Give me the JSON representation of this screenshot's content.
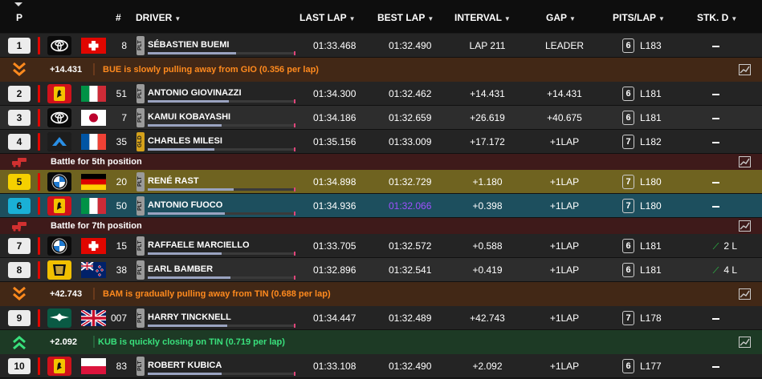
{
  "headers": {
    "pos": "P",
    "num": "#",
    "driver": "DRIVER",
    "last_lap": "LAST LAP",
    "best_lap": "BEST LAP",
    "interval": "INTERVAL",
    "gap": "GAP",
    "pits": "PITS/LAP",
    "stk": "STK. D"
  },
  "colors": {
    "team_bar": "#e10600",
    "purple_lap": "#a050ff",
    "orange_msg": "#ff8a1e",
    "green_msg": "#39e07c",
    "gain": "#2dcf4a"
  },
  "rows": [
    {
      "pos": "1",
      "num": "8",
      "tag": "PLT",
      "driver": "SÉBASTIEN BUEMI",
      "last": "01:33.468",
      "best": "01:32.490",
      "interval": "LAP 211",
      "gap": "LEADER",
      "pits": "6",
      "lap": "L183",
      "stk": "—",
      "team": "toyota",
      "flag": "switzerland"
    },
    {
      "pos": "2",
      "num": "51",
      "tag": "PLT",
      "driver": "ANTONIO GIOVINAZZI",
      "last": "01:34.300",
      "best": "01:32.462",
      "interval": "+14.431",
      "gap": "+14.431",
      "pits": "6",
      "lap": "L181",
      "stk": "—",
      "team": "ferrari",
      "flag": "italy"
    },
    {
      "pos": "3",
      "num": "7",
      "tag": "PLT",
      "driver": "KAMUI KOBAYASHI",
      "last": "01:34.186",
      "best": "01:32.659",
      "interval": "+26.619",
      "gap": "+40.675",
      "pits": "6",
      "lap": "L181",
      "stk": "—",
      "team": "toyota",
      "flag": "japan"
    },
    {
      "pos": "4",
      "num": "35",
      "tag": "GLD",
      "driver": "CHARLES MILESI",
      "last": "01:35.156",
      "best": "01:33.009",
      "interval": "+17.172",
      "gap": "+1LAP",
      "pits": "7",
      "lap": "L182",
      "stk": "—",
      "team": "alpine",
      "flag": "france"
    },
    {
      "pos": "5",
      "num": "20",
      "tag": "PLT",
      "driver": "RENÉ RAST",
      "last": "01:34.898",
      "best": "01:32.729",
      "interval": "+1.180",
      "gap": "+1LAP",
      "pits": "7",
      "lap": "L180",
      "stk": "—",
      "team": "bmw",
      "flag": "germany"
    },
    {
      "pos": "6",
      "num": "50",
      "tag": "PLT",
      "driver": "ANTONIO FUOCO",
      "last": "01:34.936",
      "best": "01:32.066",
      "interval": "+0.398",
      "gap": "+1LAP",
      "pits": "7",
      "lap": "L180",
      "stk": "—",
      "team": "ferrari",
      "flag": "italy"
    },
    {
      "pos": "7",
      "num": "15",
      "tag": "PLT",
      "driver": "RAFFAELE MARCIELLO",
      "last": "01:33.705",
      "best": "01:32.572",
      "interval": "+0.588",
      "gap": "+1LAP",
      "pits": "6",
      "lap": "L181",
      "stk": "2 L",
      "team": "bmw",
      "flag": "switzerland"
    },
    {
      "pos": "8",
      "num": "38",
      "tag": "PLT",
      "driver": "EARL BAMBER",
      "last": "01:32.896",
      "best": "01:32.541",
      "interval": "+0.419",
      "gap": "+1LAP",
      "pits": "6",
      "lap": "L181",
      "stk": "4 L",
      "team": "cadillac",
      "flag": "new-zealand"
    },
    {
      "pos": "9",
      "num": "007",
      "tag": "PLT",
      "driver": "HARRY TINCKNELL",
      "last": "01:34.447",
      "best": "01:32.489",
      "interval": "+42.743",
      "gap": "+1LAP",
      "pits": "7",
      "lap": "L178",
      "stk": "—",
      "team": "aston-martin",
      "flag": "united-kingdom"
    },
    {
      "pos": "10",
      "num": "83",
      "tag": "PLT",
      "driver": "ROBERT KUBICA",
      "last": "01:33.108",
      "best": "01:32.490",
      "interval": "+2.092",
      "gap": "+1LAP",
      "pits": "6",
      "lap": "L177",
      "stk": "—",
      "team": "ferrari",
      "flag": "poland"
    }
  ],
  "bands": [
    {
      "gap": "+14.431",
      "msg": "BUE is slowly pulling away from GIO (0.356 per lap)"
    },
    {
      "msg": "Battle for 5th position"
    },
    {
      "msg": "Battle for 7th position"
    },
    {
      "gap": "+42.743",
      "msg": "BAM is gradually pulling away from TIN (0.688 per lap)"
    },
    {
      "gap": "+2.092",
      "msg": "KUB is quickly closing on TIN (0.719 per lap)"
    }
  ],
  "pace_bars": [
    0.6,
    0.55,
    0.5,
    0.45,
    0.58,
    0.52,
    0.5,
    0.56,
    0.54,
    0.5
  ]
}
